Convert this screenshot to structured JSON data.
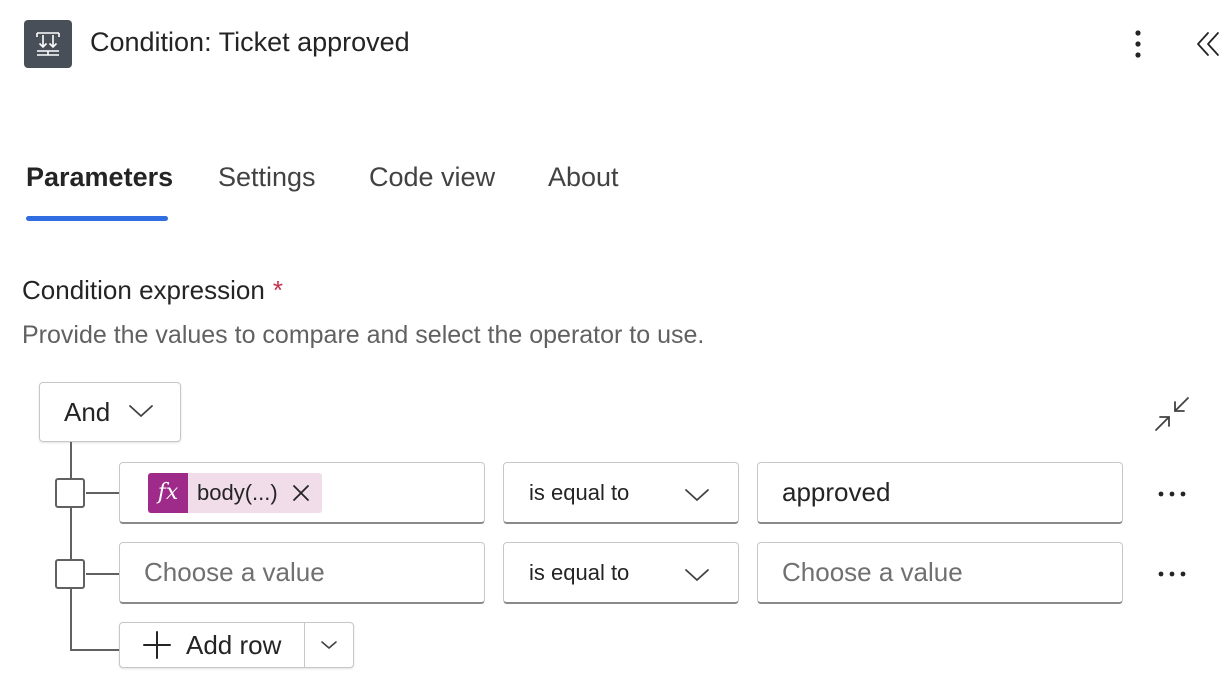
{
  "header": {
    "title": "Condition: Ticket approved",
    "icon": "condition-icon",
    "more_icon": "more-vertical-icon",
    "collapse_icon": "double-chevron-left-icon"
  },
  "tabs": [
    {
      "label": "Parameters",
      "active": true
    },
    {
      "label": "Settings",
      "active": false
    },
    {
      "label": "Code view",
      "active": false
    },
    {
      "label": "About",
      "active": false
    }
  ],
  "condition": {
    "label": "Condition expression",
    "required_mark": "*",
    "description": "Provide the values to compare and select the operator to use.",
    "group_operator": "And",
    "rows": [
      {
        "left_token": {
          "icon_text": "fx",
          "text": "body(...)"
        },
        "operator": "is equal to",
        "right_value": "approved"
      },
      {
        "left_placeholder": "Choose a value",
        "operator": "is equal to",
        "right_placeholder": "Choose a value"
      }
    ],
    "add_row_label": "Add row"
  },
  "colors": {
    "accent": "#2f6de1",
    "token_icon_bg": "#9e2a89",
    "token_bg": "#f1dcea",
    "required": "#c4314b"
  }
}
